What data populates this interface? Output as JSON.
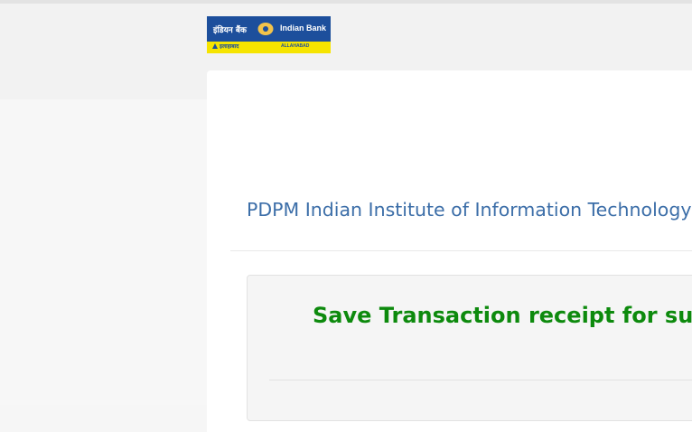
{
  "logo": {
    "hindi_name": "इंडियन बैंक",
    "english_name": "Indian Bank",
    "sub_hindi": "इलाहाबाद",
    "sub_english": "ALLAHABAD",
    "colors": {
      "blue": "#1d4f9c",
      "yellow": "#f6e400"
    }
  },
  "main": {
    "institute_title": "PDPM Indian Institute of Information Technology D",
    "receipt_message": "Save Transaction receipt for succ"
  },
  "colors": {
    "title": "#3c6ea8",
    "success": "#0d8a0d"
  }
}
